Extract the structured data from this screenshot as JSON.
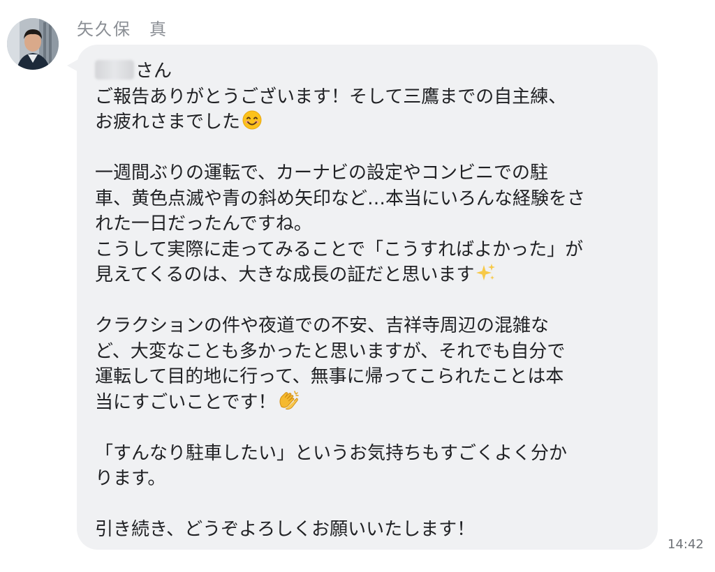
{
  "sender": {
    "name": "矢久保　真"
  },
  "message": {
    "recipient_suffix": "さん",
    "lines": {
      "l2": "ご報告ありがとうございます！そして三鷹までの自主練、",
      "l3": "お疲れさまでした",
      "l5": "一週間ぶりの運転で、カーナビの設定やコンビニでの駐",
      "l6": "車、黄色点滅や青の斜め矢印など…本当にいろんな経験をさ",
      "l7": "れた一日だったんですね。",
      "l8": "こうして実際に走ってみることで「こうすればよかった」が",
      "l9": "見えてくるのは、大きな成長の証だと思います",
      "l11": "クラクションの件や夜道での不安、吉祥寺周辺の混雑な",
      "l12": "ど、大変なことも多かったと思いますが、それでも自分で",
      "l13": "運転して目的地に行って、無事に帰ってこられたことは本",
      "l14": "当にすごいことです！",
      "l16": "「すんなり駐車したい」というお気持ちもすごくよく分か",
      "l17": "ります。",
      "l19": "引き続き、どうぞよろしくお願いいたします！"
    },
    "emojis": [
      "smiling-face-icon",
      "sparkles-icon",
      "clapping-hands-icon"
    ]
  },
  "timestamp": "14:42",
  "colors": {
    "bubble": "#f0f1f3",
    "text": "#202124",
    "sender_name": "#8a8e94",
    "timestamp": "#6f7378"
  }
}
